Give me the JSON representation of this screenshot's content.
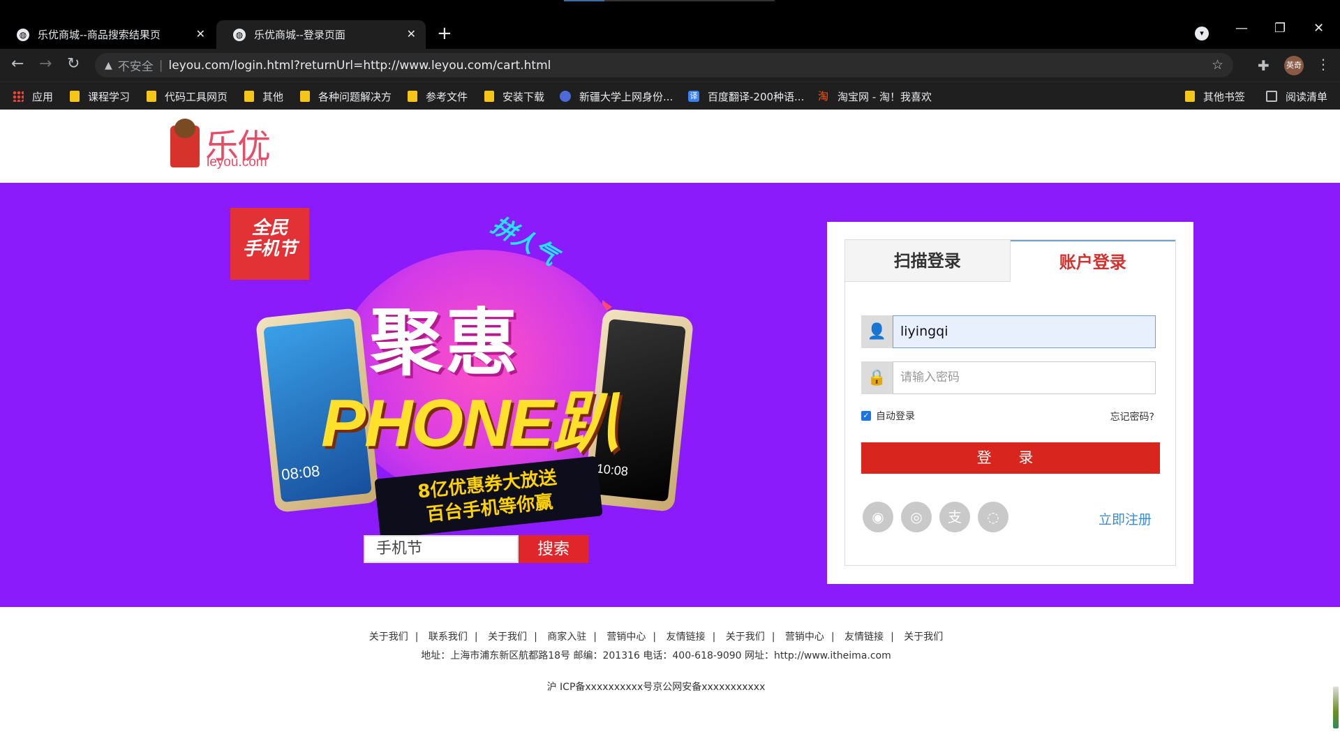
{
  "browser": {
    "tabs": [
      {
        "title": "乐优商城--商品搜索结果页",
        "active": false
      },
      {
        "title": "乐优商城--登录页面",
        "active": true
      }
    ],
    "address": {
      "security_label": "不安全",
      "url": "leyou.com/login.html?returnUrl=http://www.leyou.com/cart.html"
    },
    "profile_label": "英奇",
    "bookmarks": [
      {
        "label": "应用",
        "icon": "apps-icon"
      },
      {
        "label": "课程学习",
        "icon": "folder-icon"
      },
      {
        "label": "代码工具网页",
        "icon": "folder-icon"
      },
      {
        "label": "其他",
        "icon": "folder-icon"
      },
      {
        "label": "各种问题解决方",
        "icon": "folder-icon"
      },
      {
        "label": "参考文件",
        "icon": "folder-icon"
      },
      {
        "label": "安装下载",
        "icon": "folder-icon"
      },
      {
        "label": "新疆大学上网身份...",
        "icon": "globe-icon"
      },
      {
        "label": "百度翻译-200种语...",
        "icon": "translate-icon"
      },
      {
        "label": "淘宝网 - 淘！我喜欢",
        "icon": "taobao-icon"
      }
    ],
    "other_bookmarks": "其他书签",
    "reading_list": "阅读清单"
  },
  "header": {
    "logo_cn": "乐优",
    "logo_en": "leyou.com"
  },
  "banner": {
    "badge_text": "全民\n手机节",
    "headline": "聚惠",
    "phone_text": "PHONE趴",
    "ribbon_text": "拼人气",
    "banner_line1": "8亿优惠券大放送",
    "banner_line2": "百台手机等你赢",
    "left_phone_time": "08:08",
    "right_phone_time": "10:08",
    "search_value": "手机节",
    "search_button": "搜索",
    "background_color": "#8c1bfb"
  },
  "login": {
    "tab_scan": "扫描登录",
    "tab_account": "账户登录",
    "username_value": "liyingqi",
    "password_placeholder": "请输入密码",
    "remember_label": "自动登录",
    "remember_checked": true,
    "forgot_label": "忘记密码?",
    "login_button": "登 录",
    "register_link": "立即注册",
    "social_icons": [
      "qq-icon",
      "weibo-icon",
      "alipay-icon",
      "wechat-icon"
    ],
    "accent_color": "#d8261e"
  },
  "footer": {
    "links": [
      "关于我们",
      "联系我们",
      "关于我们",
      "商家入驻",
      "营销中心",
      "友情链接",
      "关于我们",
      "营销中心",
      "友情链接",
      "关于我们"
    ],
    "address": "地址：上海市浦东新区航都路18号 邮编：201316 电话：400-618-9090 网址：http://www.itheima.com",
    "icp": "沪 ICP备xxxxxxxxxx号京公网安备xxxxxxxxxxx"
  }
}
